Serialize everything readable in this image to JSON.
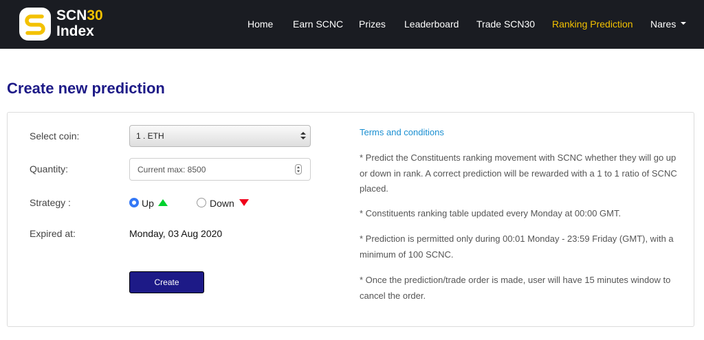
{
  "brand": {
    "name_prefix": "SCN",
    "name_highlight": "30",
    "name_line2": "Index",
    "logo_icon": "scn30-logo-icon",
    "accent_color": "#f3c100"
  },
  "nav": {
    "items": [
      {
        "label": "Home"
      },
      {
        "label": "Earn SCNC"
      },
      {
        "label": "Prizes"
      },
      {
        "label": "Leaderboard"
      },
      {
        "label": "Trade SCN30"
      },
      {
        "label": "Ranking Prediction"
      },
      {
        "label": "Nares"
      }
    ],
    "active": "Ranking Prediction",
    "user_menu_icon": "caret-down-icon"
  },
  "page": {
    "title": "Create new prediction",
    "title_color": "#1d1a87"
  },
  "form": {
    "coin_label": "Select coin:",
    "coin_selected": "1 . ETH",
    "quantity_label": "Quantity:",
    "quantity_placeholder": "Current max: 8500",
    "strategy_label": "Strategy :",
    "strategy_options": [
      {
        "label": "Up",
        "icon": "green-up-triangle-icon",
        "selected": true
      },
      {
        "label": "Down",
        "icon": "red-down-triangle-icon",
        "selected": false
      }
    ],
    "expired_label": "Expired at:",
    "expired_value": "Monday, 03 Aug 2020",
    "create_label": "Create"
  },
  "terms": {
    "title": "Terms and conditions",
    "paragraphs": [
      "* Predict the Constituents ranking movement with SCNC whether they will go up or down in rank. A correct prediction will be rewarded with a 1 to 1 ratio of SCNC placed.",
      "* Constituents ranking table updated every Monday at 00:00 GMT.",
      "* Prediction is permitted only during 00:01 Monday - 23:59 Friday (GMT), with a minimum of 100 SCNC.",
      "* Once the prediction/trade order is made, user will have 15 minutes window to cancel the order."
    ]
  }
}
